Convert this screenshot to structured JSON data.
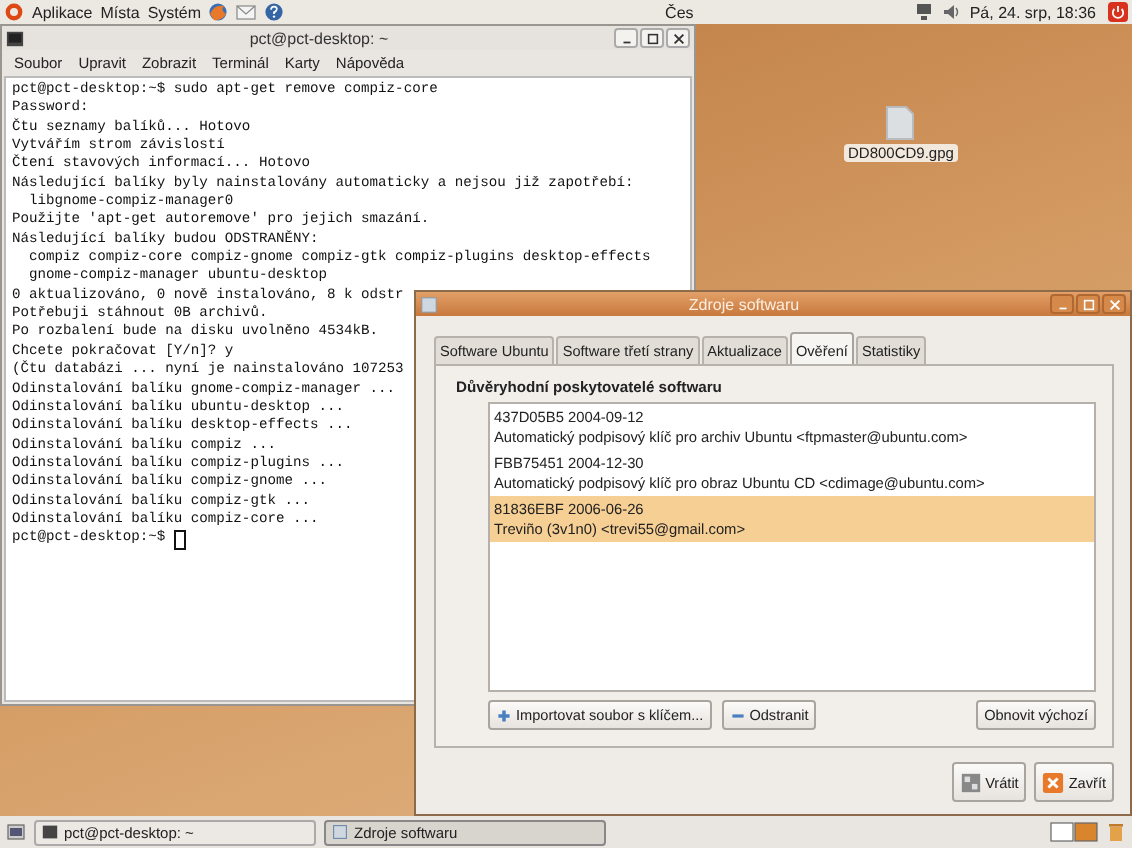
{
  "top_panel": {
    "menus": [
      "Aplikace",
      "Místa",
      "Systém"
    ],
    "keyboard": "Čes",
    "clock": "Pá, 24. srp, 18:36"
  },
  "desktop_icons": [
    {
      "label": "DD800CD9.gpg"
    }
  ],
  "terminal": {
    "title": "pct@pct-desktop: ~",
    "menu": [
      "Soubor",
      "Upravit",
      "Zobrazit",
      "Terminál",
      "Karty",
      "Nápověda"
    ],
    "lines": [
      "pct@pct-desktop:~$ sudo apt-get remove compiz-core",
      "Password:",
      "Čtu seznamy balíků... Hotovo",
      "Vytvářím strom závislostí",
      "Čtení stavových informací... Hotovo",
      "Následující balíky byly nainstalovány automaticky a nejsou již zapotřebí:",
      "  libgnome-compiz-manager0",
      "Použijte 'apt-get autoremove' pro jejich smazání.",
      "Následující balíky budou ODSTRANĚNY:",
      "  compiz compiz-core compiz-gnome compiz-gtk compiz-plugins desktop-effects",
      "  gnome-compiz-manager ubuntu-desktop",
      "0 aktualizováno, 0 nově instalováno, 8 k odstr",
      "Potřebuji stáhnout 0B archivů.",
      "Po rozbalení bude na disku uvolněno 4534kB.",
      "Chcete pokračovat [Y/n]? y",
      "(Čtu databázi ... nyní je nainstalováno 107253",
      "Odinstalování balíku gnome-compiz-manager ...",
      "Odinstalování balíku ubuntu-desktop ...",
      "Odinstalování balíku desktop-effects ...",
      "Odinstalování balíku compiz ...",
      "Odinstalování balíku compiz-plugins ...",
      "Odinstalování balíku compiz-gnome ...",
      "Odinstalování balíku compiz-gtk ...",
      "Odinstalování balíku compiz-core ...",
      "pct@pct-desktop:~$ "
    ]
  },
  "dialog": {
    "title": "Zdroje softwaru",
    "tabs": [
      {
        "label": "Software Ubuntu",
        "selected": false
      },
      {
        "label": "Software třetí strany",
        "selected": false
      },
      {
        "label": "Aktualizace",
        "selected": false
      },
      {
        "label": "Ověření",
        "selected": true
      },
      {
        "label": "Statistiky",
        "selected": false
      }
    ],
    "section_title": "Důvěryhodní poskytovatelé softwaru",
    "keys": [
      {
        "key": "437D05B5 2004-09-12",
        "description": "Automatický podpisový klíč pro archiv Ubuntu <ftpmaster@ubuntu.com>",
        "selected": false
      },
      {
        "key": "FBB75451 2004-12-30",
        "description": "Automatický podpisový klíč pro obraz Ubuntu CD <cdimage@ubuntu.com>",
        "selected": false
      },
      {
        "key": "81836EBF 2006-06-26",
        "description": "Treviño (3v1n0) <trevi55@gmail.com>",
        "selected": true
      }
    ],
    "key_buttons": [
      {
        "label": "Importovat soubor s klíčem...",
        "kind": "add"
      },
      {
        "label": "Odstranit",
        "kind": "remove"
      },
      {
        "label": "Obnovit výchozí",
        "kind": "plain"
      }
    ],
    "footer_buttons": [
      {
        "label": "Vrátit",
        "kind": "revert"
      },
      {
        "label": "Zavřít",
        "kind": "close"
      }
    ]
  },
  "taskbar": {
    "items": [
      {
        "label": "pct@pct-desktop: ~",
        "kind": "terminal",
        "selected": false
      },
      {
        "label": "Zdroje softwaru",
        "kind": "dialog",
        "selected": true
      }
    ]
  }
}
